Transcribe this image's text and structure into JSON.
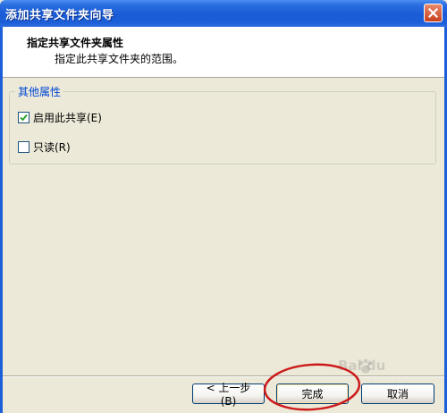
{
  "window": {
    "title": "添加共享文件夹向导"
  },
  "header": {
    "title": "指定共享文件夹属性",
    "subtitle": "指定此共享文件夹的范围。"
  },
  "group": {
    "title": "其他属性",
    "options": [
      {
        "label": "启用此共享(E)",
        "checked": true
      },
      {
        "label": "只读(R)",
        "checked": false
      }
    ]
  },
  "buttons": {
    "back": "< 上一步(B)",
    "finish": "完成",
    "cancel": "取消"
  },
  "watermark": {
    "text": "Bai du",
    "sub": "jingyan.baidu.com"
  },
  "annotation_color": "#cc1a1a"
}
